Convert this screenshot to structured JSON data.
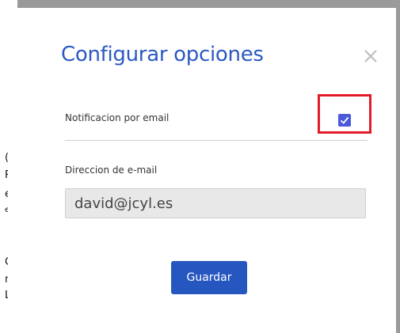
{
  "background": {
    "text_fragments": [
      "(",
      "R",
      "e",
      "e",
      "G",
      "n",
      "L"
    ]
  },
  "modal": {
    "title": "Configurar opciones",
    "close_icon": "close-icon",
    "notification_label": "Notificacion por email",
    "notification_checked": true,
    "email_label": "Direccion de e-mail",
    "email_value": "david@jcyl.es",
    "save_label": "Guardar"
  },
  "colors": {
    "title": "#2b59c3",
    "checkbox": "#4a5ad9",
    "highlight": "#e21b2a",
    "button": "#2657c1"
  }
}
